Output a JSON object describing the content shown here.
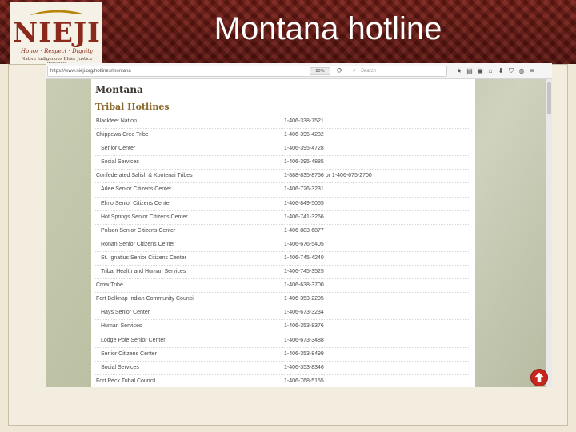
{
  "slide": {
    "title": "Montana hotline",
    "logo": {
      "text": "NIEJI",
      "tagline": "Honor · Respect · Dignity",
      "subtitle": "Native Indigenous Elder Justice Initiative"
    }
  },
  "browser": {
    "url": "https://www.nieji.org/hotlines/montana",
    "zoom": "80%",
    "search_placeholder": "Search",
    "toolbar_icons": [
      "star-icon",
      "clipboard-icon",
      "lock-icon",
      "home-icon",
      "download-icon",
      "shield-icon",
      "chat-icon",
      "menu-icon"
    ]
  },
  "page": {
    "heading": "Montana",
    "subheading": "Tribal Hotlines",
    "hotlines": [
      {
        "name": "Blackfeet Nation",
        "phone": "1-406-338-7521",
        "indent": false
      },
      {
        "name": "Chippewa Cree Tribe",
        "phone": "1-406-395-4282",
        "indent": false
      },
      {
        "name": "Senior Center",
        "phone": "1-406-395-4728",
        "indent": true
      },
      {
        "name": "Social Services",
        "phone": "1-406-395-4885",
        "indent": true
      },
      {
        "name": "Confederated Salish & Kootenai Tribes",
        "phone": "1-888-835-8766 or 1-406-675-2700",
        "indent": false
      },
      {
        "name": "Arlee Senior Citizens Center",
        "phone": "1-406-726-3231",
        "indent": true
      },
      {
        "name": "Elmo Senior Citizens Center",
        "phone": "1-406-849-5055",
        "indent": true
      },
      {
        "name": "Hot Springs Senior Citizens Center",
        "phone": "1-406-741-3266",
        "indent": true
      },
      {
        "name": "Polson Senior Citizens Center",
        "phone": "1-406-883-6877",
        "indent": true
      },
      {
        "name": "Ronan Senior Citizens Center",
        "phone": "1-406-676-5405",
        "indent": true
      },
      {
        "name": "St. Ignatius Senior Citizens Center",
        "phone": "1-406-745-4240",
        "indent": true
      },
      {
        "name": "Tribal Health and Human Services",
        "phone": "1-406-745-3525",
        "indent": true
      },
      {
        "name": "Crow Tribe",
        "phone": "1-406-638-3700",
        "indent": false
      },
      {
        "name": "Fort Belknap Indian Community Council",
        "phone": "1-406-353-2205",
        "indent": false
      },
      {
        "name": "Hays Senior Center",
        "phone": "1-406-673-3234",
        "indent": true
      },
      {
        "name": "Human Services",
        "phone": "1-406-353-8376",
        "indent": true
      },
      {
        "name": "Lodge Pole Senior Center",
        "phone": "1-406-673-3488",
        "indent": true
      },
      {
        "name": "Senior Citizens Center",
        "phone": "1-406-353-8499",
        "indent": true
      },
      {
        "name": "Social Services",
        "phone": "1-406-353-8346",
        "indent": true
      },
      {
        "name": "Fort Peck Tribal Council",
        "phone": "1-406-768-5155",
        "indent": false
      }
    ]
  },
  "colors": {
    "header_red": "#7a1f17",
    "heading_gold": "#8c6a2c",
    "back_to_top_red": "#c8261d"
  }
}
